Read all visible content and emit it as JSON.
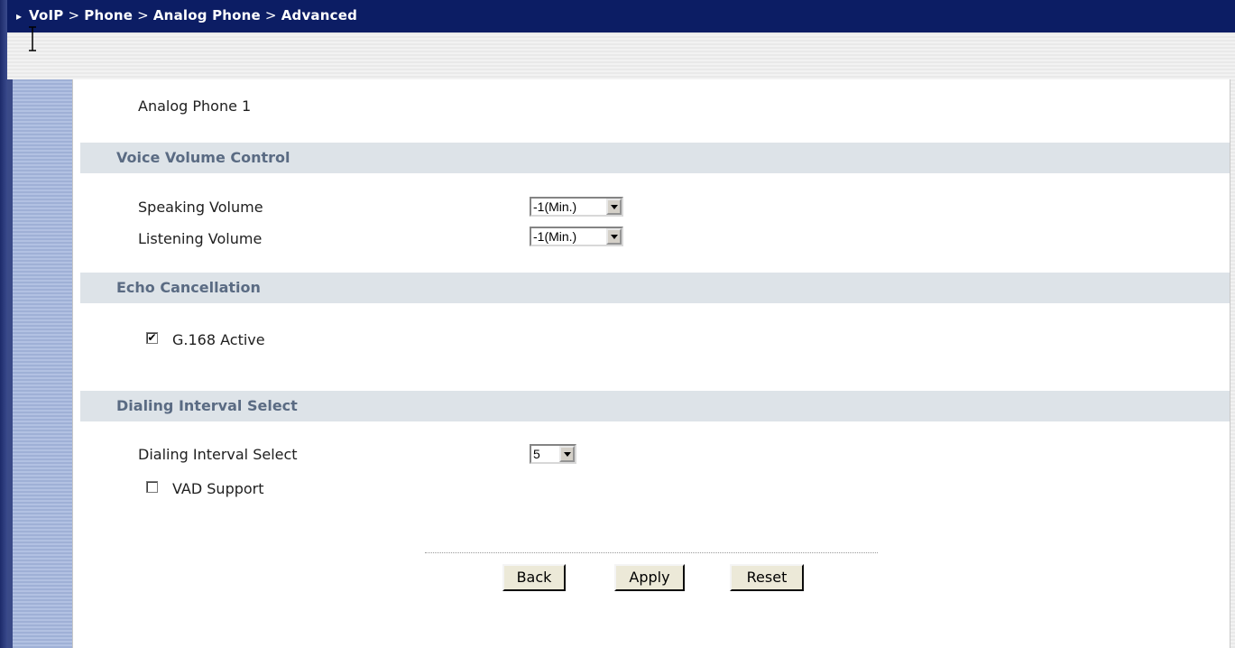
{
  "header": {
    "breadcrumb": [
      "VoIP",
      "Phone",
      "Analog Phone",
      "Advanced"
    ],
    "separator": ">"
  },
  "page": {
    "phone_label": "Analog Phone 1"
  },
  "sections": {
    "voice_volume": {
      "title": "Voice Volume Control",
      "speaking_label": "Speaking Volume",
      "speaking_value": "-1(Min.)",
      "listening_label": "Listening Volume",
      "listening_value": "-1(Min.)"
    },
    "echo": {
      "title": "Echo Cancellation",
      "g168_label": "G.168 Active",
      "g168_checked": true
    },
    "dialing": {
      "title": "Dialing Interval Select",
      "interval_label": "Dialing Interval Select",
      "interval_value": "5",
      "vad_label": "VAD Support",
      "vad_checked": false
    }
  },
  "buttons": {
    "back": "Back",
    "apply": "Apply",
    "reset": "Reset"
  },
  "colors": {
    "titlebar": "#0c1d64",
    "section_bg": "#dde3e8",
    "section_text": "#5a6b83"
  }
}
